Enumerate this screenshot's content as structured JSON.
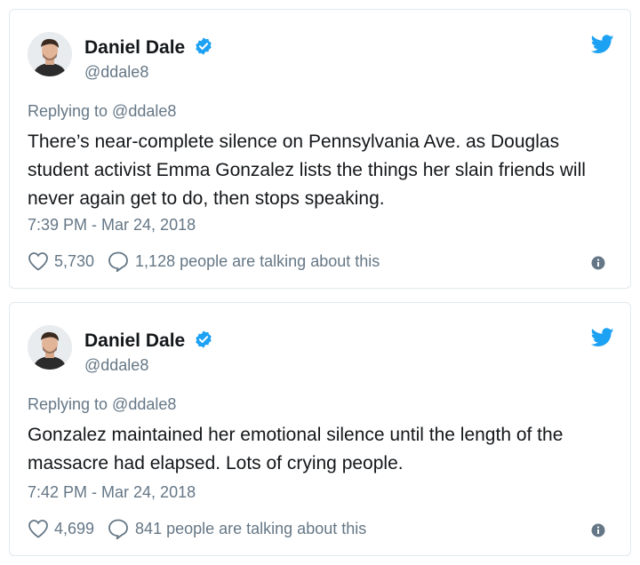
{
  "colors": {
    "accent": "#1da1f2",
    "text": "#14171a",
    "muted": "#657786",
    "border": "#e1e8ed"
  },
  "tweets": [
    {
      "author_name": "Daniel Dale",
      "author_handle": "@ddale8",
      "replying_to": "Replying to @ddale8",
      "text": "There’s near-complete silence on Pennsylvania Ave. as Douglas student activist Emma Gonzalez lists the things her slain friends will never again get to do, then stops speaking.",
      "timestamp": "7:39 PM - Mar 24, 2018",
      "likes": "5,730",
      "talking": "1,128 people are talking about this",
      "icons": [
        "verified-icon",
        "twitter-bird-icon",
        "heart-icon",
        "speech-bubble-icon",
        "info-icon"
      ]
    },
    {
      "author_name": "Daniel Dale",
      "author_handle": "@ddale8",
      "replying_to": "Replying to @ddale8",
      "text": "Gonzalez maintained her emotional silence until the length of the massacre had elapsed. Lots of crying people.",
      "timestamp": "7:42 PM - Mar 24, 2018",
      "likes": "4,699",
      "talking": "841 people are talking about this",
      "icons": [
        "verified-icon",
        "twitter-bird-icon",
        "heart-icon",
        "speech-bubble-icon",
        "info-icon"
      ]
    }
  ]
}
